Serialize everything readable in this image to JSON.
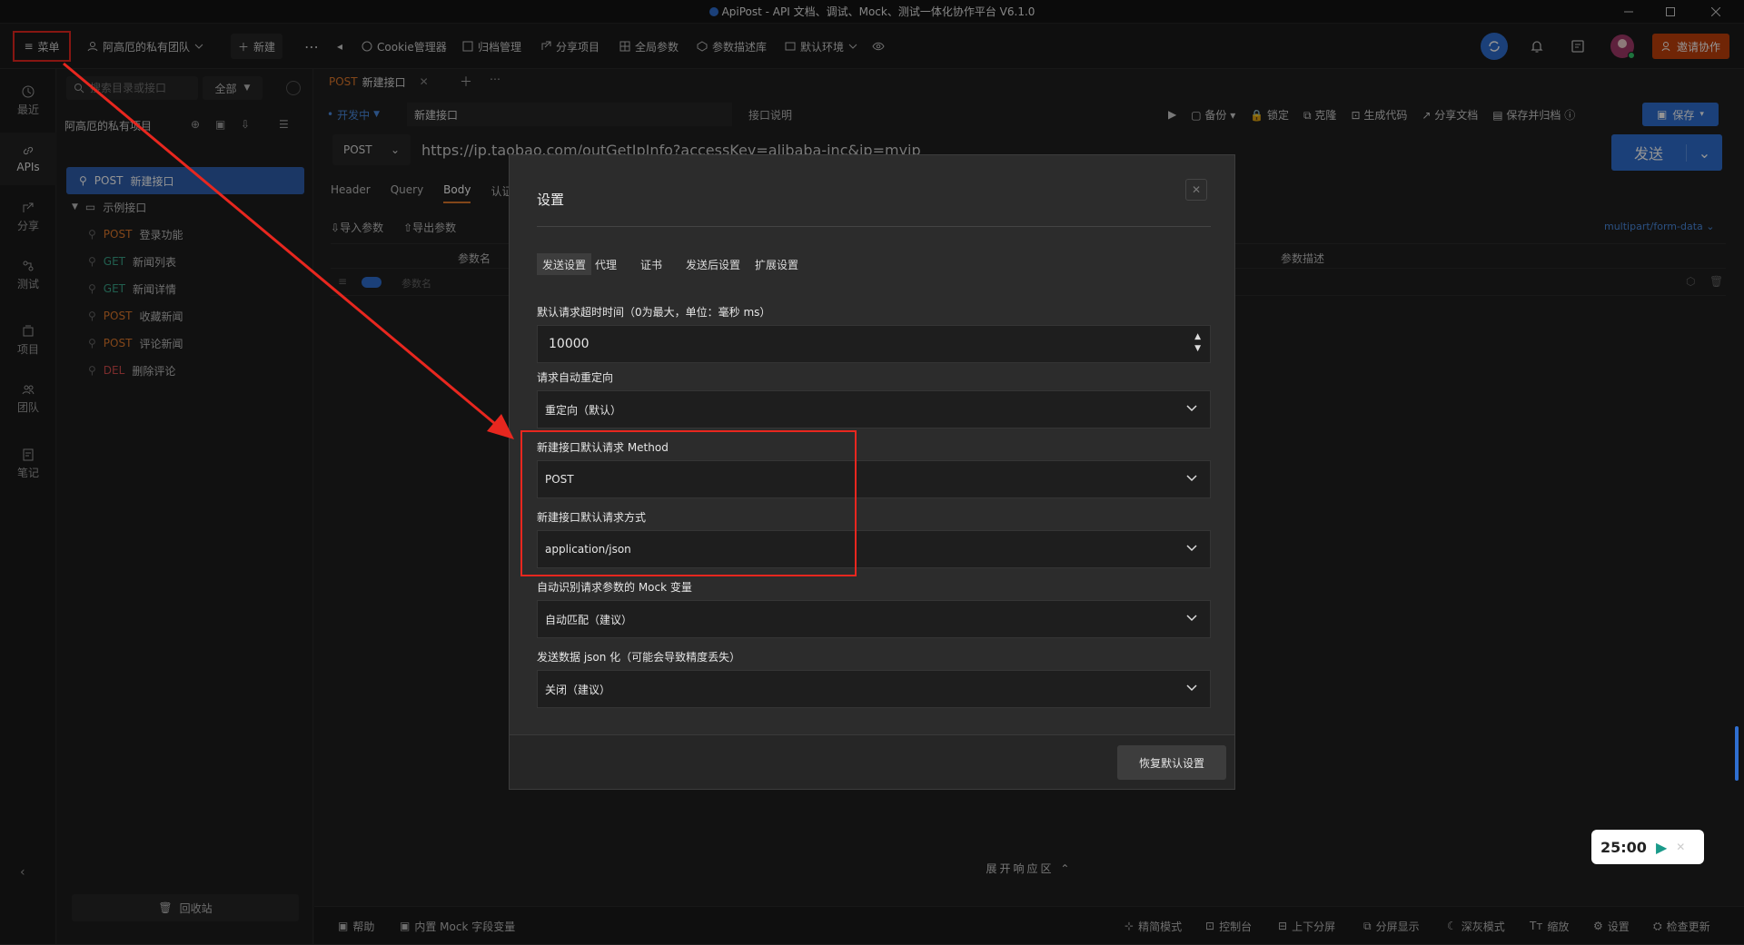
{
  "window": {
    "title": "ApiPost - API 文档、调试、Mock、测试一体化协作平台 V6.1.0"
  },
  "toolbar": {
    "menu": "菜单",
    "team": "阿高厄的私有团队",
    "new": "新建",
    "cookie": "Cookie管理器",
    "archive": "归档管理",
    "share_project": "分享项目",
    "global_params": "全局参数",
    "param_desc": "参数描述库",
    "env": "默认环境",
    "invite": "邀请协作"
  },
  "rail": {
    "items": [
      "最近",
      "APIs",
      "分享",
      "测试",
      "项目",
      "团队",
      "笔记"
    ]
  },
  "tree": {
    "search_placeholder": "搜索目录或接口",
    "filter": "全部",
    "project": "阿高厄的私有项目",
    "selected": {
      "method": "POST",
      "name": "新建接口"
    },
    "folder": "示例接口",
    "items": [
      {
        "method": "POST",
        "name": "登录功能"
      },
      {
        "method": "GET",
        "name": "新闻列表"
      },
      {
        "method": "GET",
        "name": "新闻详情"
      },
      {
        "method": "POST",
        "name": "收藏新闻"
      },
      {
        "method": "POST",
        "name": "评论新闻"
      },
      {
        "method": "DEL",
        "name": "删除评论"
      }
    ],
    "recycle": "回收站"
  },
  "editor": {
    "tab_method": "POST",
    "tab_name": "新建接口",
    "status": "开发中",
    "api_name": "新建接口",
    "api_desc": "接口说明",
    "actions": [
      "备份",
      "锁定",
      "克隆",
      "生成代码",
      "分享文档",
      "保存并归档"
    ],
    "save": "保存",
    "method": "POST",
    "url": "https://ip.taobao.com/outGetIpInfo?accessKey=alibaba-inc&ip=myip",
    "send": "发送",
    "req_tabs": [
      "Header",
      "Query",
      "Body",
      "认证"
    ],
    "import": "导入参数",
    "export": "导出参数",
    "content_type": "multipart/form-data",
    "col_name": "参数名",
    "col_desc": "参数描述",
    "name_placeholder": "参数名",
    "response_area": "展开响应区"
  },
  "dialog": {
    "title": "设置",
    "tabs": [
      "发送设置",
      "代理",
      "证书",
      "发送后设置",
      "扩展设置"
    ],
    "fields": [
      {
        "label": "默认请求超时时间（0为最大，单位：毫秒 ms）",
        "value": "10000"
      },
      {
        "label": "请求自动重定向",
        "value": "重定向（默认）"
      },
      {
        "label": "新建接口默认请求 Method",
        "value": "POST"
      },
      {
        "label": "新建接口默认请求方式",
        "value": "application/json"
      },
      {
        "label": "自动识别请求参数的 Mock 变量",
        "value": "自动匹配（建议）"
      },
      {
        "label": "发送数据 json 化（可能会导致精度丢失）",
        "value": "关闭（建议）"
      }
    ],
    "reset": "恢复默认设置"
  },
  "bottom": {
    "help": "帮助",
    "mock": "内置 Mock 字段变量",
    "right": [
      "精简模式",
      "控制台",
      "上下分屏",
      "分屏显示",
      "深灰模式",
      "缩放",
      "设置",
      "检查更新"
    ]
  },
  "timer": {
    "value": "25:00"
  },
  "colors": {
    "accent": "#2f6fd1",
    "annotation": "#e8271f",
    "invite": "#c2410c"
  }
}
